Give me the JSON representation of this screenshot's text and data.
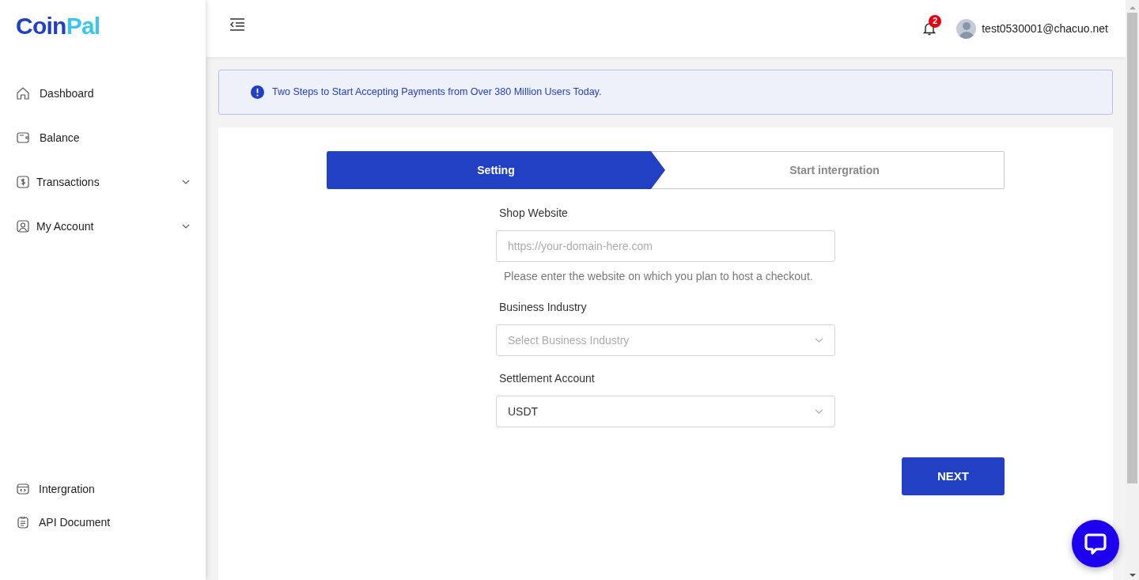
{
  "logo": {
    "primary": "Coin",
    "accent": "Pal"
  },
  "sidebar": {
    "items": [
      {
        "label": "Dashboard",
        "selected": false
      },
      {
        "label": "Balance",
        "selected": false
      },
      {
        "label": "Transactions",
        "selected": false,
        "expanded": false
      },
      {
        "label": "My Account",
        "selected": false,
        "expanded": false
      }
    ],
    "bottom_items": [
      {
        "label": "Intergration"
      },
      {
        "label": "API Document"
      }
    ]
  },
  "header": {
    "notification_count": "2",
    "user_email": "test0530001@chacuo.net"
  },
  "banner": {
    "text": "Two Steps to Start Accepting Payments from Over 380 Million Users Today."
  },
  "steps": [
    {
      "label": "Setting",
      "selected": true
    },
    {
      "label": "Start intergration",
      "selected": false
    }
  ],
  "form": {
    "fields": [
      {
        "kind": "text",
        "label": "Shop Website",
        "placeholder": "https://your-domain-here.com",
        "help": "Please enter the website on which you plan to host a checkout."
      },
      {
        "kind": "select",
        "label": "Business Industry",
        "placeholder": "Select Business Industry"
      },
      {
        "kind": "select",
        "label": "Settlement Account",
        "value": "USDT"
      }
    ]
  },
  "next_button": "NEXT"
}
